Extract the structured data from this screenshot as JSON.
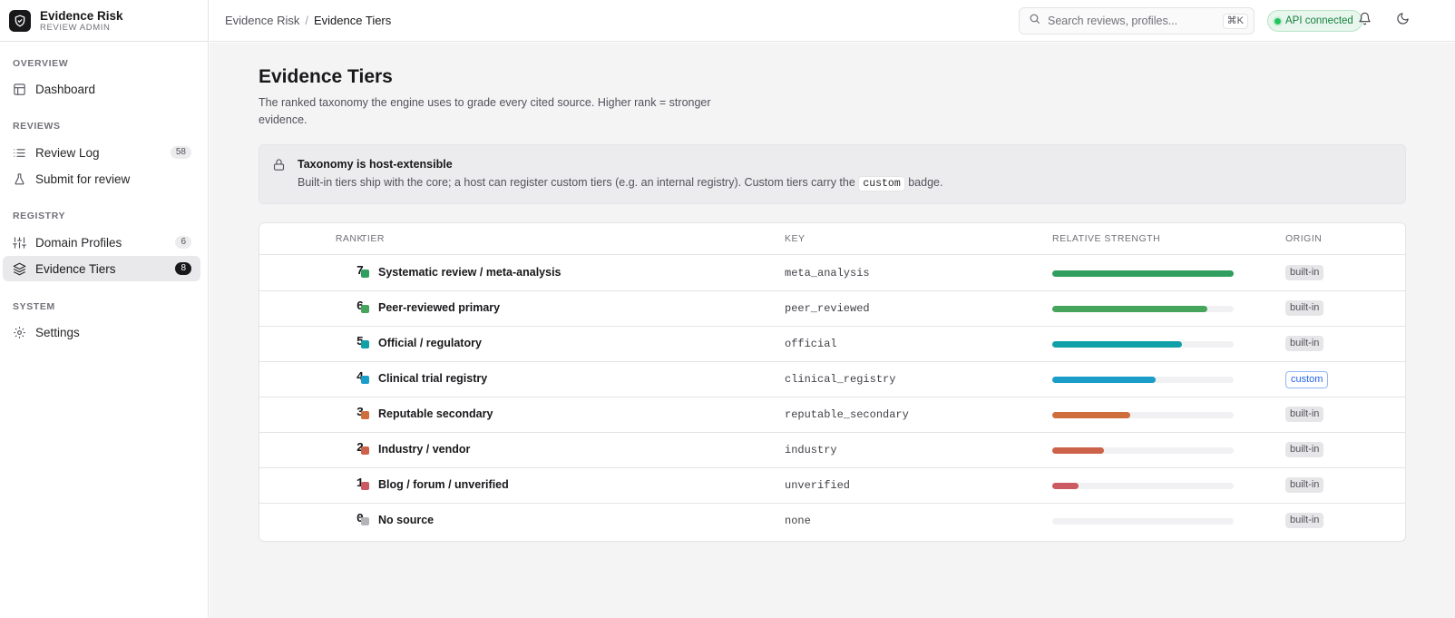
{
  "brand": {
    "name": "Evidence Risk",
    "subtitle": "REVIEW ADMIN"
  },
  "sidebar": {
    "sections": [
      {
        "label": "OVERVIEW"
      },
      {
        "label": "REVIEWS"
      },
      {
        "label": "REGISTRY"
      },
      {
        "label": "SYSTEM"
      }
    ],
    "items": [
      {
        "label": "Dashboard",
        "icon": "layout-icon"
      },
      {
        "label": "Review Log",
        "icon": "list-icon",
        "count": "58"
      },
      {
        "label": "Submit for review",
        "icon": "flask-icon"
      },
      {
        "label": "Domain Profiles",
        "icon": "sliders-icon",
        "count": "6"
      },
      {
        "label": "Evidence Tiers",
        "icon": "layers-icon",
        "count": "8",
        "active": true
      },
      {
        "label": "Settings",
        "icon": "gear-icon"
      }
    ]
  },
  "header": {
    "breadcrumb": [
      "Evidence Risk",
      "Evidence Tiers"
    ],
    "search_placeholder": "Search reviews, profiles...",
    "search_shortcut": "⌘K",
    "api_status": "API connected"
  },
  "page": {
    "title": "Evidence Tiers",
    "description": "The ranked taxonomy the engine uses to grade every cited source. Higher rank = stronger evidence."
  },
  "notice": {
    "title": "Taxonomy is host-extensible",
    "body_before": "Built-in tiers ship with the core; a host can register custom tiers (e.g. an internal registry). Custom tiers carry the",
    "code": "custom",
    "body_after": "badge."
  },
  "table": {
    "headers": {
      "rank": "RANK",
      "tier": "TIER",
      "key": "KEY",
      "strength": "RELATIVE STRENGTH",
      "origin": "ORIGIN"
    },
    "rows": [
      {
        "rank": "7",
        "tier": "Systematic review / meta-analysis",
        "key": "meta_analysis",
        "strength": 1.0,
        "color": "#2f9e5e",
        "origin": "built-in"
      },
      {
        "rank": "6",
        "tier": "Peer-reviewed primary",
        "key": "peer_reviewed",
        "strength": 0.857,
        "color": "#45a55c",
        "origin": "built-in"
      },
      {
        "rank": "5",
        "tier": "Official / regulatory",
        "key": "official",
        "strength": 0.714,
        "color": "#12a0a8",
        "origin": "built-in"
      },
      {
        "rank": "4",
        "tier": "Clinical trial registry",
        "key": "clinical_registry",
        "strength": 0.571,
        "color": "#1a9ec9",
        "origin": "custom"
      },
      {
        "rank": "3",
        "tier": "Reputable secondary",
        "key": "reputable_secondary",
        "strength": 0.429,
        "color": "#cf6e3d",
        "origin": "built-in"
      },
      {
        "rank": "2",
        "tier": "Industry / vendor",
        "key": "industry",
        "strength": 0.286,
        "color": "#cc6249",
        "origin": "built-in"
      },
      {
        "rank": "1",
        "tier": "Blog / forum / unverified",
        "key": "unverified",
        "strength": 0.143,
        "color": "#cc5a62",
        "origin": "built-in"
      },
      {
        "rank": "0",
        "tier": "No source",
        "key": "none",
        "strength": 0.0,
        "color": "#b4b4b8",
        "origin": "built-in"
      }
    ]
  }
}
